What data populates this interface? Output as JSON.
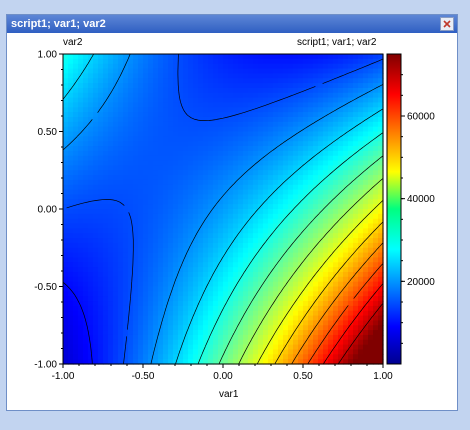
{
  "window": {
    "title": "script1; var1; var2"
  },
  "icons": {
    "close": "close-icon"
  },
  "plot": {
    "y_header": "var2",
    "right_header": "script1; var1; var2",
    "xlabel": "var1"
  },
  "chart_data": {
    "type": "heatmap",
    "title": "script1; var1; var2",
    "xlabel": "var1",
    "ylabel": "var2",
    "xlim": [
      -1.0,
      1.0
    ],
    "ylim": [
      -1.0,
      1.0
    ],
    "x_ticks": [
      "-1.00",
      "-0.50",
      "0.00",
      "0.50",
      "1.00"
    ],
    "y_ticks": [
      "1.00",
      "0.50",
      "0.00",
      "-0.50",
      "-1.00"
    ],
    "colorbar": {
      "range": [
        0,
        75000
      ],
      "ticks": [
        {
          "value": 60000,
          "label": "60000"
        },
        {
          "value": 40000,
          "label": "40000"
        },
        {
          "value": 20000,
          "label": "20000"
        }
      ]
    },
    "colormap": "jet",
    "contours": true
  }
}
